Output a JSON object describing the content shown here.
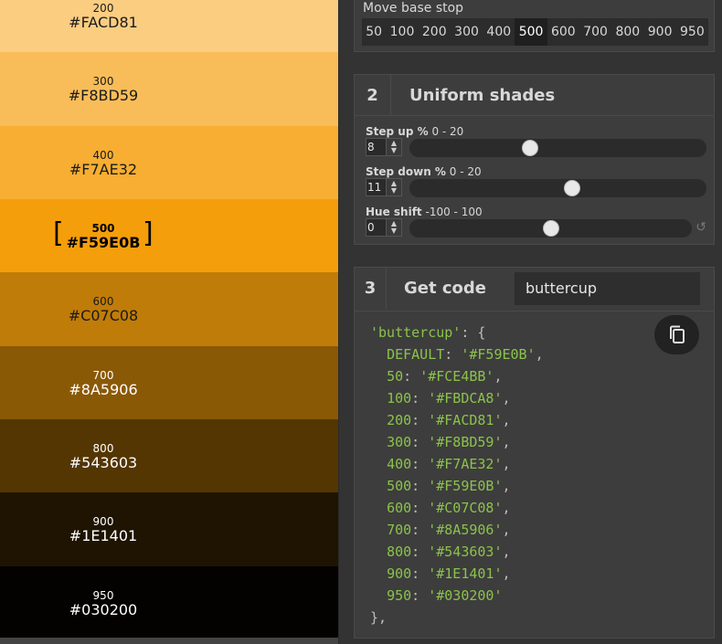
{
  "swatches": [
    {
      "stop": "200",
      "hex": "#FACD81",
      "color": "#FACD81",
      "text_color": "#1a1a1a",
      "selected": false
    },
    {
      "stop": "300",
      "hex": "#F8BD59",
      "color": "#F8BD59",
      "text_color": "#1a1a1a",
      "selected": false
    },
    {
      "stop": "400",
      "hex": "#F7AE32",
      "color": "#F7AE32",
      "text_color": "#1a1a1a",
      "selected": false
    },
    {
      "stop": "500",
      "hex": "#F59E0B",
      "color": "#F59E0B",
      "text_color": "#000000",
      "selected": true
    },
    {
      "stop": "600",
      "hex": "#C07C08",
      "color": "#C07C08",
      "text_color": "#1a1a1a",
      "selected": false
    },
    {
      "stop": "700",
      "hex": "#8A5906",
      "color": "#8A5906",
      "text_color": "#ffffff",
      "selected": false
    },
    {
      "stop": "800",
      "hex": "#543603",
      "color": "#543603",
      "text_color": "#ffffff",
      "selected": false
    },
    {
      "stop": "900",
      "hex": "#1E1401",
      "color": "#1E1401",
      "text_color": "#ffffff",
      "selected": false
    },
    {
      "stop": "950",
      "hex": "#030200",
      "color": "#030200",
      "text_color": "#ffffff",
      "selected": false
    }
  ],
  "bracket_left": "[",
  "bracket_right": "]",
  "base": {
    "title": "Move base stop",
    "stops": [
      "50",
      "100",
      "200",
      "300",
      "400",
      "500",
      "600",
      "700",
      "800",
      "900",
      "950"
    ],
    "active": "500"
  },
  "uniform": {
    "num": "2",
    "title": "Uniform shades",
    "step_up": {
      "label": "Step up %",
      "range": "0 - 20",
      "value": "8",
      "fraction": 0.4
    },
    "step_down": {
      "label": "Step down %",
      "range": "0 - 20",
      "value": "11",
      "fraction": 0.55
    },
    "hue_shift": {
      "label": "Hue shift",
      "range": "-100 - 100",
      "value": "0",
      "fraction": 0.5
    }
  },
  "code": {
    "num": "3",
    "title": "Get code",
    "name": "buttercup",
    "default_label": "DEFAULT",
    "default_value": "'#F59E0B'",
    "entries": [
      {
        "k": "50",
        "v": "'#FCE4BB'"
      },
      {
        "k": "100",
        "v": "'#FBDCA8'"
      },
      {
        "k": "200",
        "v": "'#FACD81'"
      },
      {
        "k": "300",
        "v": "'#F8BD59'"
      },
      {
        "k": "400",
        "v": "'#F7AE32'"
      },
      {
        "k": "500",
        "v": "'#F59E0B'"
      },
      {
        "k": "600",
        "v": "'#C07C08'"
      },
      {
        "k": "700",
        "v": "'#8A5906'"
      },
      {
        "k": "800",
        "v": "'#543603'"
      },
      {
        "k": "900",
        "v": "'#1E1401'"
      },
      {
        "k": "950",
        "v": "'#030200'"
      }
    ]
  },
  "icons": {
    "copy": "copy-icon",
    "reset": "reset-icon"
  }
}
